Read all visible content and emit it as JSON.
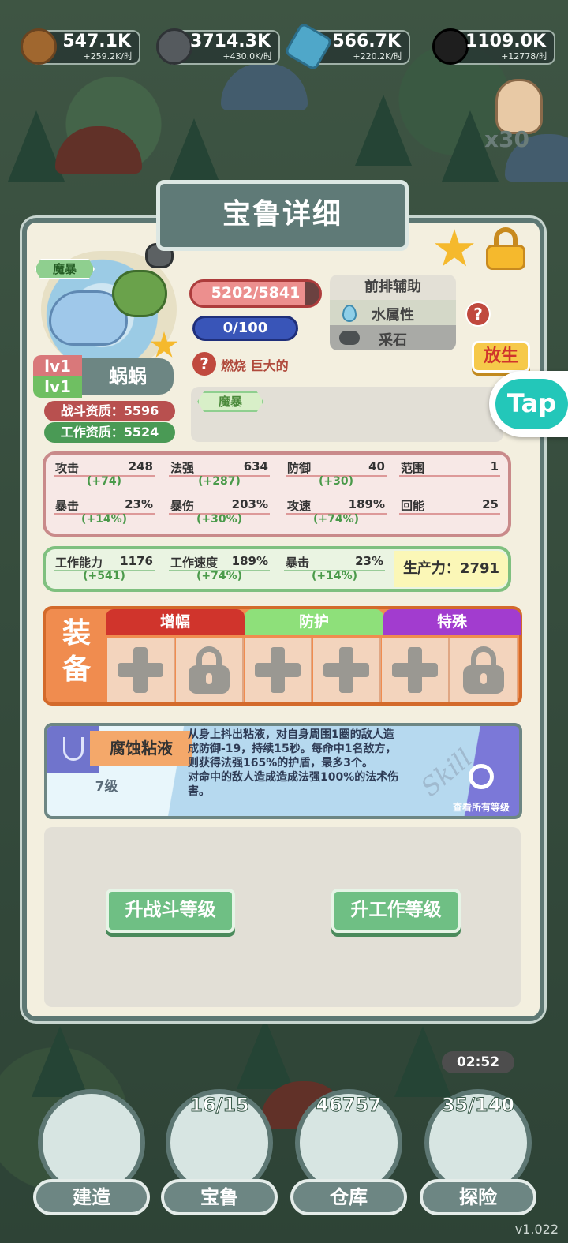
{
  "resources": [
    {
      "icon": "wood-log-icon",
      "value": "547.1K",
      "rate": "+259.2K/时",
      "color": "#a0672f"
    },
    {
      "icon": "stone-icon",
      "value": "3714.3K",
      "rate": "+430.0K/时",
      "color": "#555a5e"
    },
    {
      "icon": "crystal-icon",
      "value": "566.7K",
      "rate": "+220.2K/时",
      "color": "#4fa7c9"
    },
    {
      "icon": "coal-icon",
      "value": "1109.0K",
      "rate": "+12778/时",
      "color": "#1e1e1e"
    }
  ],
  "side": {
    "hand_count": "x30",
    "tap_logo": "Tap"
  },
  "panel": {
    "title": "宝鲁详细",
    "tag": "魔暴",
    "level_combat": "lv1",
    "level_work": "lv1",
    "name": "蜗蜗",
    "combat_aptitude": "战斗资质：5596",
    "work_aptitude": "工作资质：5524",
    "hp": "5202/5841",
    "hp_fraction": 0.89,
    "energy": "0/100",
    "traits": "燃烧  巨大的",
    "role": "前排辅助",
    "element": "水属性",
    "work_type": "采石",
    "release_label": "放生",
    "skill_tag": "魔暴"
  },
  "combat_stats": [
    {
      "name": "攻击",
      "value": "248",
      "bonus": "(+74)"
    },
    {
      "name": "法强",
      "value": "634",
      "bonus": "(+287)"
    },
    {
      "name": "防御",
      "value": "40",
      "bonus": "(+30)"
    },
    {
      "name": "范围",
      "value": "1",
      "bonus": ""
    },
    {
      "name": "暴击",
      "value": "23%",
      "bonus": "(+14%)"
    },
    {
      "name": "暴伤",
      "value": "203%",
      "bonus": "(+30%)"
    },
    {
      "name": "攻速",
      "value": "189%",
      "bonus": "(+74%)"
    },
    {
      "name": "回能",
      "value": "25",
      "bonus": ""
    }
  ],
  "work_stats": [
    {
      "name": "工作能力",
      "value": "1176",
      "bonus": "(+541)"
    },
    {
      "name": "工作速度",
      "value": "189%",
      "bonus": "(+74%)"
    },
    {
      "name": "暴击",
      "value": "23%",
      "bonus": "(+14%)"
    }
  ],
  "productivity": "生产力：2791",
  "equipment": {
    "label_top": "装",
    "label_bottom": "备",
    "categories": [
      {
        "name": "增幅",
        "color": "#d0342c"
      },
      {
        "name": "防护",
        "color": "#8ee07a"
      },
      {
        "name": "特殊",
        "color": "#a23ccf"
      }
    ],
    "slots": [
      "plus",
      "lock",
      "plus",
      "plus",
      "plus",
      "lock"
    ]
  },
  "skill": {
    "name": "腐蚀粘液",
    "level": "7级",
    "desc1": "从身上抖出粘液，对自身周围1圈的敌人造",
    "desc2": "成防御-19，持续15秒。每命中1名敌方，",
    "desc3": "则获得法强165%的护盾，最多3个。",
    "desc4": "对命中的敌人造成造成法强100%的法术伤",
    "desc5": "害。",
    "watermark": "Skill",
    "view_all": "查看所有等级"
  },
  "buttons": {
    "upgrade_combat": "升战斗等级",
    "upgrade_work": "升工作等级"
  },
  "nav": [
    {
      "label": "建造",
      "count": "",
      "icon": "build-icon"
    },
    {
      "label": "宝鲁",
      "count": "16/15",
      "icon": "creature-icon"
    },
    {
      "label": "仓库",
      "count": "46757",
      "icon": "chest-icon"
    },
    {
      "label": "探险",
      "count": "35/140",
      "icon": "explore-icon",
      "timer": "02:52"
    }
  ],
  "version": "v1.022"
}
